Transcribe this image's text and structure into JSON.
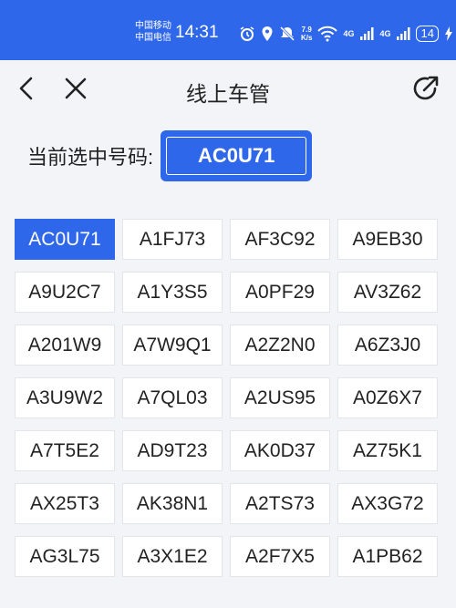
{
  "status": {
    "carrier1": "中国移动",
    "carrier2": "中国电信",
    "time": "14:31",
    "speed_value": "7.9",
    "speed_unit": "K/s",
    "net1": "4G",
    "net2": "4G",
    "battery": "14"
  },
  "appbar": {
    "title": "线上车管"
  },
  "current": {
    "label": "当前选中号码:",
    "value": "AC0U71"
  },
  "plates": [
    "AC0U71",
    "A1FJ73",
    "AF3C92",
    "A9EB30",
    "A9U2C7",
    "A1Y3S5",
    "A0PF29",
    "AV3Z62",
    "A201W9",
    "A7W9Q1",
    "A2Z2N0",
    "A6Z3J0",
    "A3U9W2",
    "A7QL03",
    "A2US95",
    "A0Z6X7",
    "A7T5E2",
    "AD9T23",
    "AK0D37",
    "AZ75K1",
    "AX25T3",
    "AK38N1",
    "A2TS73",
    "AX3G72",
    "AG3L75",
    "A3X1E2",
    "A2F7X5",
    "A1PB62"
  ],
  "selected_index": 0,
  "colors": {
    "accent": "#2f67ea",
    "page_bg": "#f3f4f7"
  }
}
